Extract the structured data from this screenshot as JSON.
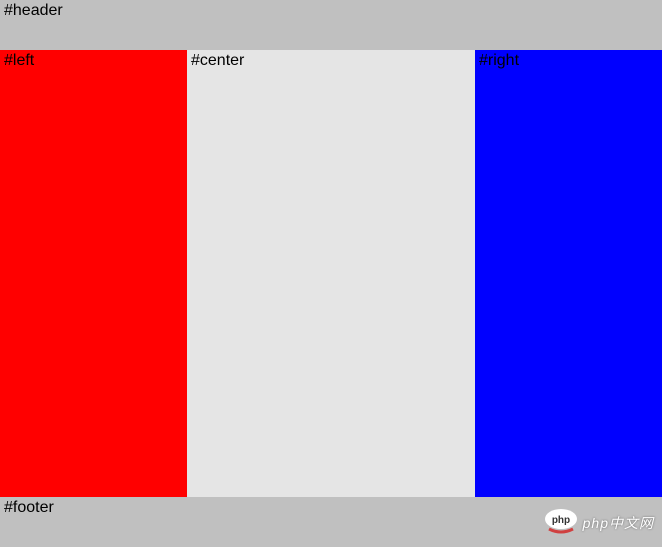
{
  "header": {
    "label": "#header"
  },
  "left": {
    "label": "#left"
  },
  "center": {
    "label": "#center"
  },
  "right": {
    "label": "#right"
  },
  "footer": {
    "label": "#footer"
  },
  "watermark": {
    "text": "php中文网"
  },
  "colors": {
    "header_bg": "#c0c0c0",
    "footer_bg": "#c0c0c0",
    "left_bg": "#ff0000",
    "center_bg": "#e5e5e5",
    "right_bg": "#0000ff"
  }
}
